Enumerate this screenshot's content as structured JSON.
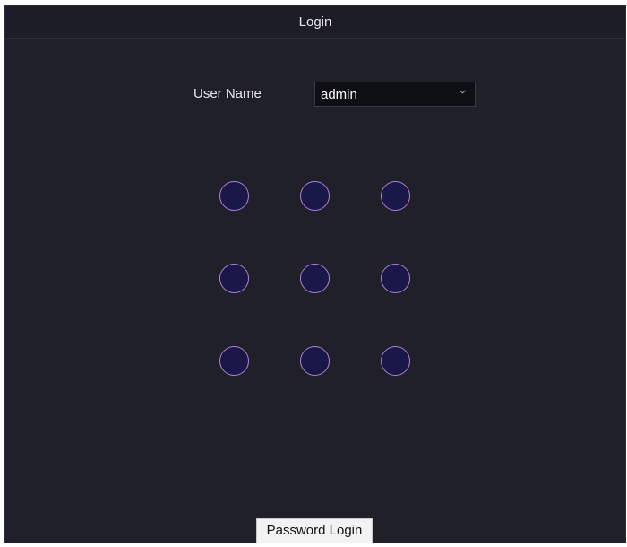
{
  "window": {
    "title": "Login"
  },
  "form": {
    "user_name_label": "User Name",
    "user_name_value": "admin",
    "dropdown_icon": "chevron-down-icon"
  },
  "pattern_lock": {
    "rows": 3,
    "columns": 3,
    "node_color": "#1a1849",
    "node_border_color": "#b27fd0"
  },
  "actions": {
    "password_login_label": "Password Login"
  },
  "colors": {
    "background": "#1f2029",
    "title_bar": "#1c1d26",
    "input_background": "#0e0f14",
    "text": "#e6e6ea"
  }
}
